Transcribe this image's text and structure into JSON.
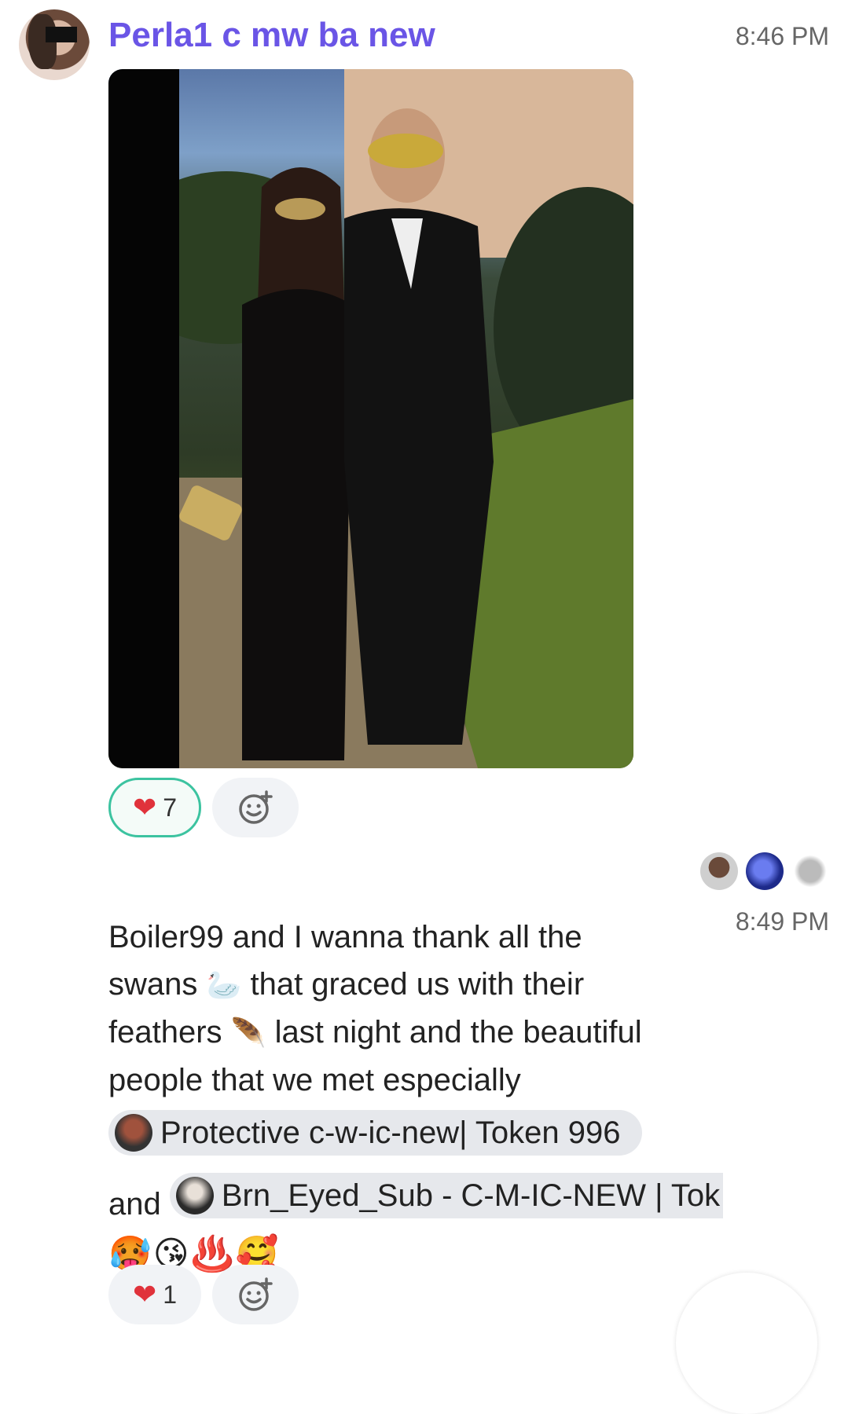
{
  "message1": {
    "sender": "Perla1 c mw ba new",
    "time": "8:46 PM",
    "reactions": [
      {
        "icon": "heart-icon",
        "emoji": "❤️",
        "count": "7",
        "active": true
      }
    ]
  },
  "message2": {
    "time": "8:49 PM",
    "text_lines": [
      "Boiler99 and I wanna thank all the",
      "that graced us with their",
      "last night and the beautiful",
      "people that we met especially"
    ],
    "word_swans": "swans",
    "word_feathers": "feathers",
    "emoji_swan": "🦢",
    "emoji_feather": "🪶",
    "mention1": "Protective c-w-ic-new| Token 996",
    "and_word": "and",
    "mention2": "Brn_Eyed_Sub - C-M-IC-NEW | Tok",
    "emoji_row": "🥵😘♨️🥰",
    "reactions": [
      {
        "icon": "heart-icon",
        "emoji": "❤️",
        "count": "1",
        "active": false
      }
    ]
  },
  "colors": {
    "sender_name": "#6a55e6",
    "reaction_active_border": "#3cc3a0",
    "mention_bg": "#e6e8ec"
  }
}
